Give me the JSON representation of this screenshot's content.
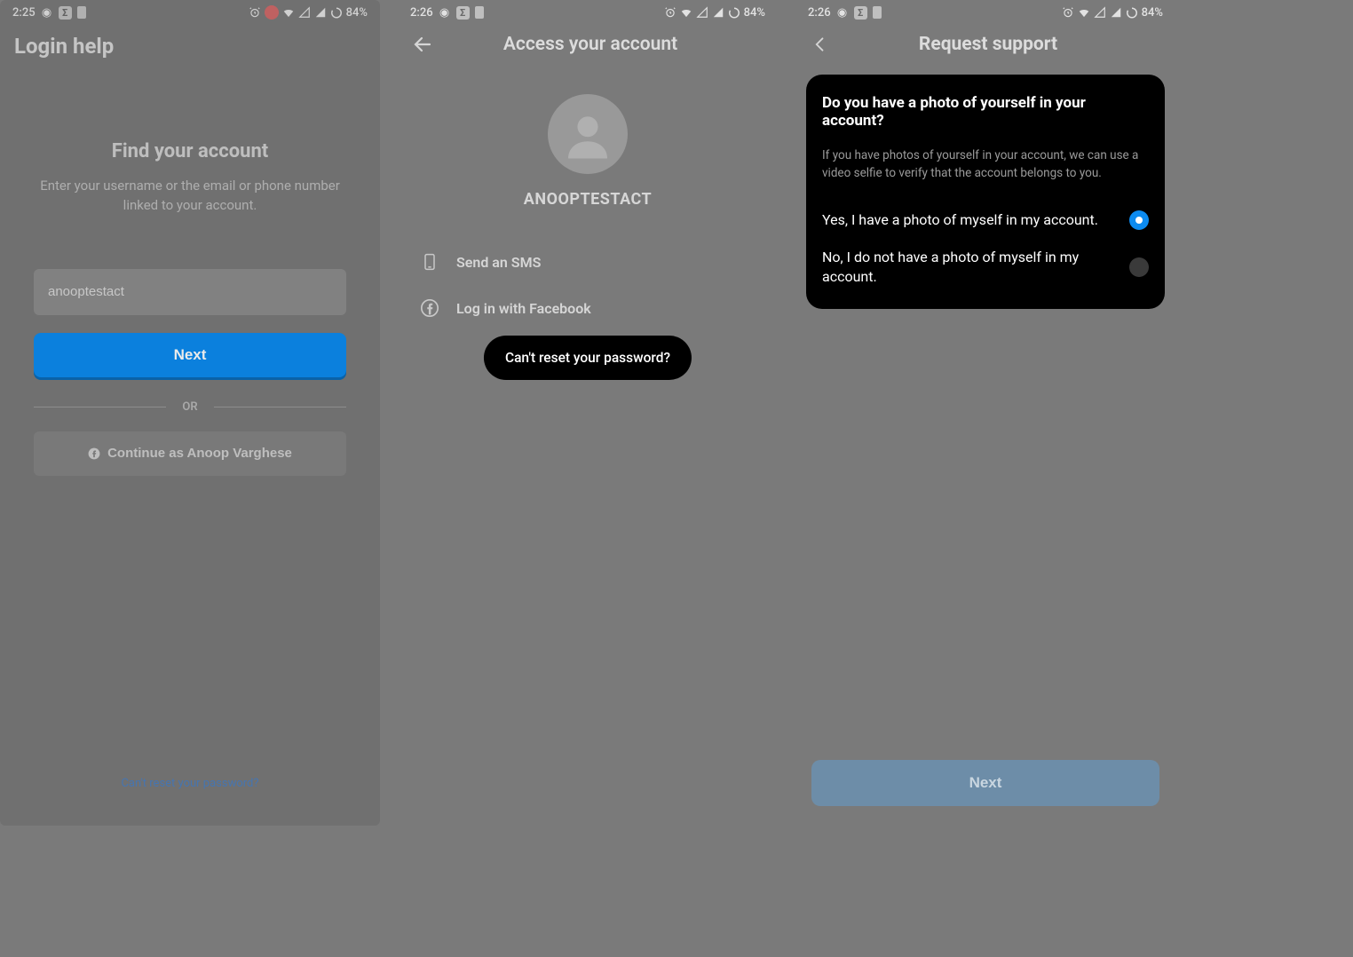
{
  "status": {
    "battery": "84%",
    "screens": [
      {
        "time": "2:25"
      },
      {
        "time": "2:26"
      },
      {
        "time": "2:26"
      }
    ]
  },
  "screen1": {
    "header": "Login help",
    "heading": "Find your account",
    "subtext": "Enter your username or the email or phone number linked to your account.",
    "input_value": "anooptestact",
    "next_label": "Next",
    "divider": "OR",
    "fb_label": "Continue as Anoop Varghese",
    "bottom_link": "Can't reset your password?"
  },
  "screen2": {
    "header": "Access your account",
    "username": "ANOOPTESTACT",
    "opt_sms": "Send an SMS",
    "opt_fb": "Log in with Facebook",
    "tooltip": "Can't reset your password?"
  },
  "screen3": {
    "header": "Request support",
    "question": "Do you have a photo of yourself in your account?",
    "description": "If you have photos of yourself in your account, we can use a video selfie to verify that the account belongs to you.",
    "opt_yes": "Yes, I have a photo of myself in my account.",
    "opt_no": "No, I do not have a photo of myself in my account.",
    "next_label": "Next"
  }
}
